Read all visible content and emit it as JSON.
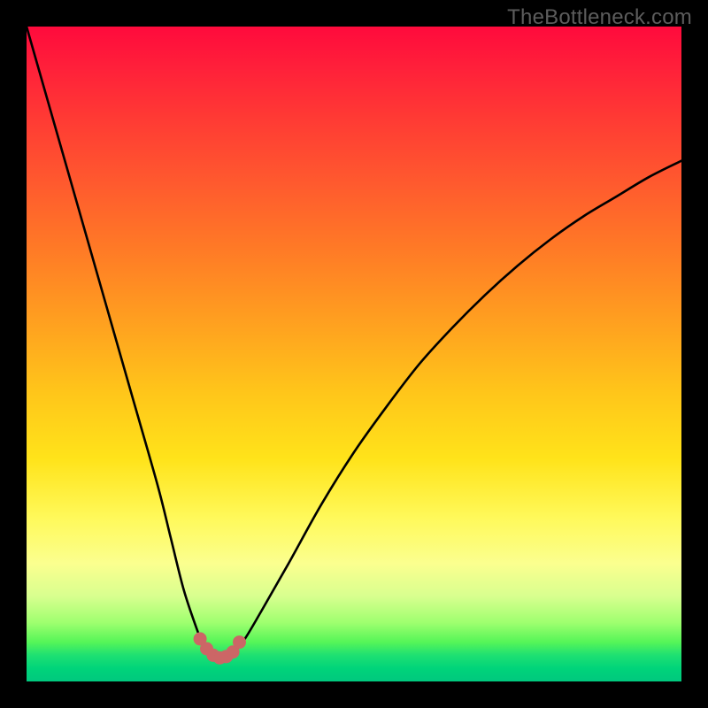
{
  "watermark": "TheBottleneck.com",
  "colors": {
    "frame": "#000000",
    "curve_stroke": "#000000",
    "marker_fill": "#cc6666",
    "marker_stroke": "#cc6666"
  },
  "chart_data": {
    "type": "line",
    "title": "",
    "xlabel": "",
    "ylabel": "",
    "xlim": [
      0,
      100
    ],
    "ylim": [
      0,
      100
    ],
    "grid": false,
    "series": [
      {
        "name": "bottleneck-curve",
        "x": [
          0,
          4,
          8,
          12,
          16,
          20,
          22,
          24,
          26,
          27,
          28,
          29,
          30,
          31,
          33,
          36,
          40,
          45,
          50,
          55,
          60,
          65,
          70,
          75,
          80,
          85,
          90,
          95,
          100
        ],
        "y": [
          100,
          86,
          72,
          58,
          44,
          30,
          22,
          14,
          8,
          5.5,
          4,
          3.5,
          3.5,
          4,
          6,
          11,
          18,
          27,
          35,
          42,
          48.5,
          54,
          59,
          63.5,
          67.5,
          71,
          74,
          77,
          79.5
        ]
      },
      {
        "name": "cusp-markers",
        "x": [
          26.5,
          27.5,
          28.5,
          29.5,
          30.5,
          31.5,
          32.5
        ],
        "y": [
          6.5,
          5,
          4,
          3.6,
          3.8,
          4.5,
          6
        ]
      }
    ],
    "annotations": [
      {
        "text": "TheBottleneck.com",
        "pos": "top-right"
      }
    ]
  }
}
